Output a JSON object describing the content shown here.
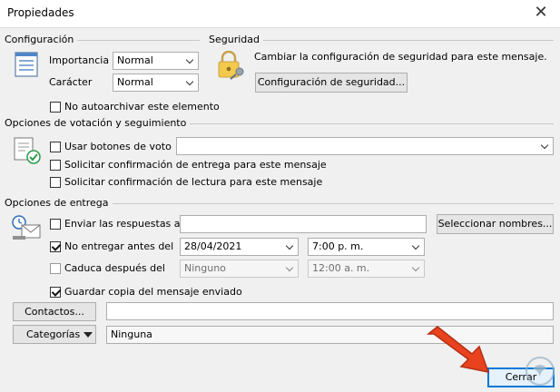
{
  "window": {
    "title": "Propiedades",
    "close_glyph": "✕"
  },
  "config": {
    "heading": "Configuración",
    "importance_label": "Importancia",
    "importance_value": "Normal",
    "character_label": "Carácter",
    "character_value": "Normal",
    "no_autoarchive_label": "No autoarchivar este elemento"
  },
  "security": {
    "heading": "Seguridad",
    "description": "Cambiar la configuración de seguridad para este mensaje.",
    "button_label": "Configuración de seguridad..."
  },
  "voting": {
    "heading": "Opciones de votación y seguimiento",
    "use_vote_buttons_label": "Usar botones de voto",
    "delivery_receipt_label": "Solicitar confirmación de entrega para este mensaje",
    "read_receipt_label": "Solicitar confirmación de lectura para este mensaje"
  },
  "delivery": {
    "heading": "Opciones de entrega",
    "send_replies_label": "Enviar las respuestas a",
    "select_names_button": "Seleccionar nombres...",
    "no_deliver_before_label": "No entregar antes del",
    "no_deliver_date": "28/04/2021",
    "no_deliver_time": "7:00 p. m.",
    "expires_after_label": "Caduca después del",
    "expires_date": "Ninguno",
    "expires_time": "12:00 a. m.",
    "save_copy_label": "Guardar copia del mensaje enviado"
  },
  "contacts": {
    "button_label": "Contactos..."
  },
  "categories": {
    "button_label": "Categorías",
    "value": "Ninguna"
  },
  "footer": {
    "close_button_label": "Cerrar"
  },
  "states": {
    "no_autoarchive": false,
    "use_vote_buttons": false,
    "delivery_receipt": false,
    "read_receipt": false,
    "send_replies": false,
    "no_deliver_before": true,
    "expires_after": false,
    "save_copy": true
  },
  "colors": {
    "accent": "#0078d7",
    "annotation_arrow": "#e8421f",
    "watermark": "#9ab4c8"
  }
}
